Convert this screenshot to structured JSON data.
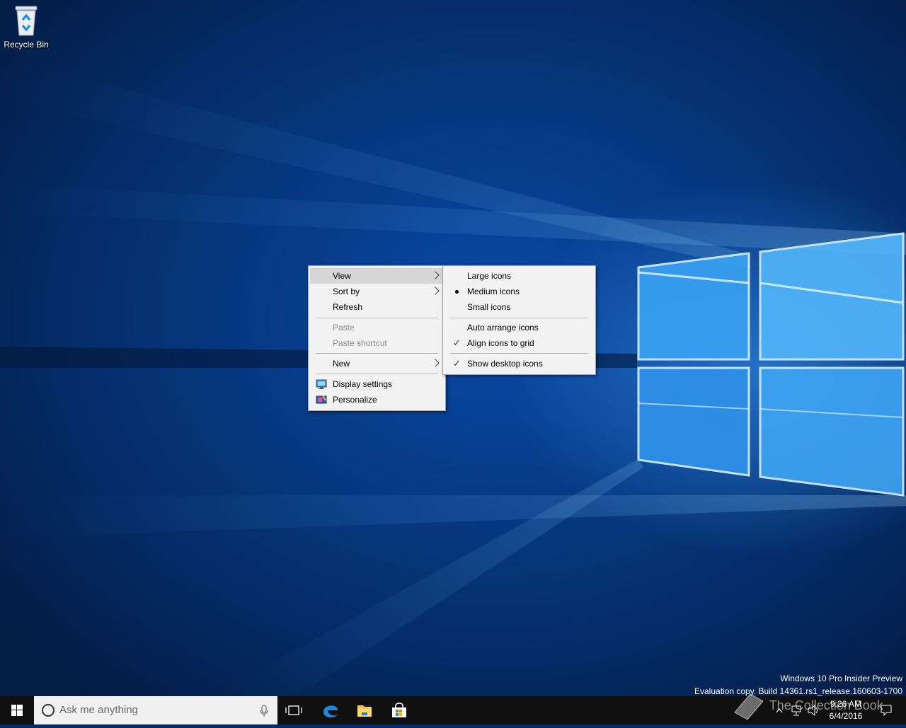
{
  "desktop": {
    "recycle_bin_label": "Recycle Bin"
  },
  "context_menu": {
    "items": [
      {
        "label": "View",
        "has_submenu": true,
        "highlighted": true
      },
      {
        "label": "Sort by",
        "has_submenu": true
      },
      {
        "label": "Refresh"
      },
      {
        "label": "Paste",
        "disabled": true
      },
      {
        "label": "Paste shortcut",
        "disabled": true
      },
      {
        "label": "New",
        "has_submenu": true
      },
      {
        "label": "Display settings",
        "icon": "display-settings-icon"
      },
      {
        "label": "Personalize",
        "icon": "personalize-icon"
      }
    ]
  },
  "view_submenu": {
    "items": [
      {
        "label": "Large icons"
      },
      {
        "label": "Medium icons",
        "selected": true
      },
      {
        "label": "Small icons"
      },
      {
        "label": "Auto arrange icons"
      },
      {
        "label": "Align icons to grid",
        "checked": true
      },
      {
        "label": "Show desktop icons",
        "checked": true
      }
    ]
  },
  "watermark": {
    "line1": "Windows 10 Pro Insider Preview",
    "line2": "Evaluation copy. Build 14361.rs1_release.160603-1700"
  },
  "taskbar": {
    "search_placeholder": "Ask me anything",
    "time": "9:26 AM",
    "date": "6/4/2016",
    "overlay_text": "The Collection Book"
  }
}
